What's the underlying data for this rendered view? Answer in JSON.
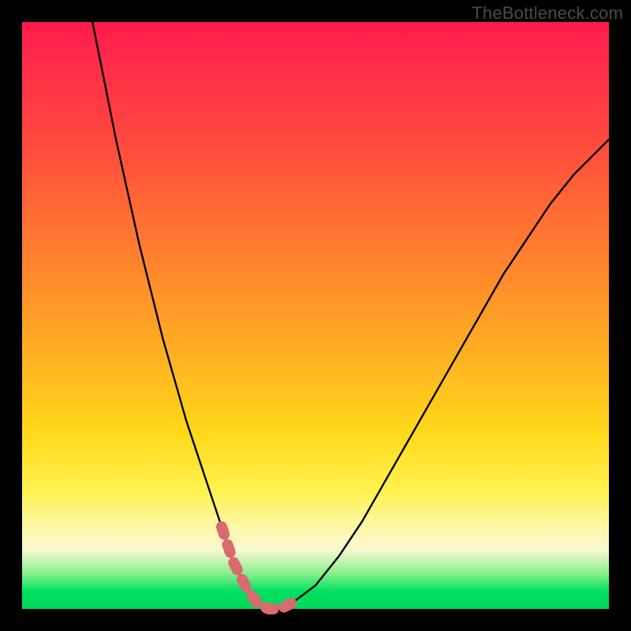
{
  "watermark": "TheBottleneck.com",
  "chart_data": {
    "type": "line",
    "title": "",
    "xlabel": "",
    "ylabel": "",
    "xlim": [
      0,
      100
    ],
    "ylim": [
      0,
      100
    ],
    "grid": false,
    "legend": false,
    "series": [
      {
        "name": "curve",
        "color": "#000000",
        "x": [
          12,
          14,
          16,
          18,
          20,
          22,
          24,
          26,
          28,
          30,
          32,
          34,
          35,
          36,
          38,
          40,
          42,
          44,
          46,
          50,
          54,
          58,
          62,
          66,
          70,
          74,
          78,
          82,
          86,
          90,
          94,
          98,
          100
        ],
        "y": [
          100,
          90,
          80,
          71,
          62,
          54,
          46,
          39,
          32,
          26,
          20,
          14,
          11,
          8,
          4,
          1,
          0,
          0,
          1,
          4,
          9,
          15,
          22,
          29,
          36,
          43,
          50,
          57,
          63,
          69,
          74,
          78,
          80
        ]
      },
      {
        "name": "highlight-near-min",
        "color": "#d96a6f",
        "x": [
          34,
          35,
          36,
          38,
          40,
          42,
          44,
          45,
          46
        ],
        "y": [
          14,
          11,
          8,
          4,
          1,
          0,
          0,
          0.5,
          1
        ]
      }
    ],
    "annotations": []
  },
  "colors": {
    "frame": "#000000",
    "curve": "#000000",
    "highlight": "#d96a6f",
    "gradient_stops": [
      "#ff1a4d",
      "#ff6a33",
      "#ffd91a",
      "#f8f8d0",
      "#00d85a"
    ]
  }
}
